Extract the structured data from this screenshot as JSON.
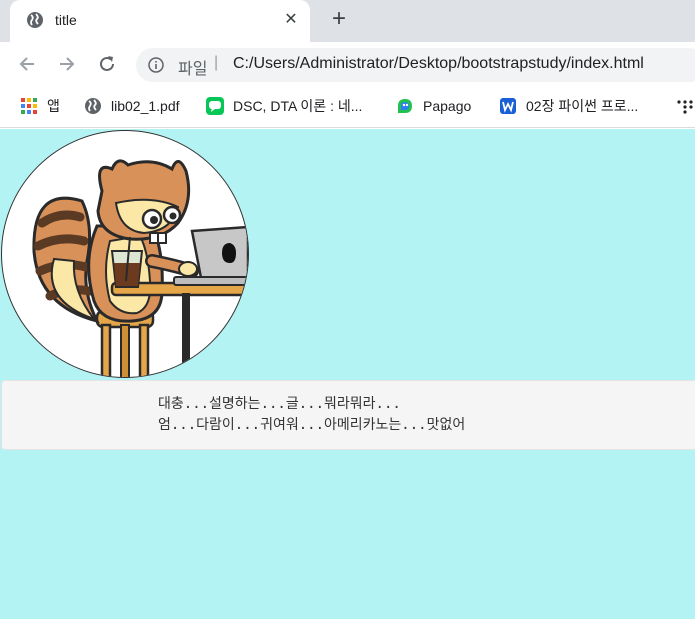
{
  "browser": {
    "tab": {
      "title": "title",
      "close_glyph": "✕"
    },
    "new_tab_glyph": "+",
    "omnibox": {
      "prefix": "파일",
      "separator": "|",
      "url": "C:/Users/Administrator/Desktop/bootstrapstudy/index.html"
    },
    "bookmarks": [
      {
        "icon": "apps-grid-icon",
        "label": "앱"
      },
      {
        "icon": "globe-icon",
        "label": "lib02_1.pdf"
      },
      {
        "icon": "line-chat-icon",
        "label": "DSC, DTA 이론 : 네..."
      },
      {
        "icon": "papago-icon",
        "label": "Papago"
      },
      {
        "icon": "bookmark-w-icon",
        "label": "02장 파이썬 프로..."
      }
    ]
  },
  "page": {
    "description_lines": [
      "대충...설명하는...글...뭐라뭐라...",
      "엄...다람이...귀여워...아메리카노는...맛없어"
    ]
  },
  "colors": {
    "page_background": "#b4f3f3",
    "well_background": "#f5f5f5",
    "tabstrip": "#dee1e6"
  }
}
